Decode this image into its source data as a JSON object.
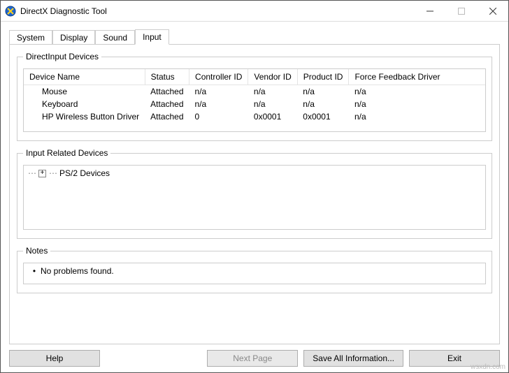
{
  "window": {
    "title": "DirectX Diagnostic Tool"
  },
  "tabs": {
    "items": [
      "System",
      "Display",
      "Sound",
      "Input"
    ],
    "active": "Input"
  },
  "groups": {
    "devices": {
      "legend": "DirectInput Devices",
      "columns": [
        "Device Name",
        "Status",
        "Controller ID",
        "Vendor ID",
        "Product ID",
        "Force Feedback Driver"
      ],
      "rows": [
        {
          "name": "Mouse",
          "status": "Attached",
          "controller": "n/a",
          "vendor": "n/a",
          "product": "n/a",
          "ffd": "n/a"
        },
        {
          "name": "Keyboard",
          "status": "Attached",
          "controller": "n/a",
          "vendor": "n/a",
          "product": "n/a",
          "ffd": "n/a"
        },
        {
          "name": "HP Wireless Button Driver",
          "status": "Attached",
          "controller": "0",
          "vendor": "0x0001",
          "product": "0x0001",
          "ffd": "n/a"
        }
      ]
    },
    "related": {
      "legend": "Input Related Devices",
      "tree": {
        "node0": "PS/2 Devices",
        "expander": "+"
      }
    },
    "notes": {
      "legend": "Notes",
      "items": [
        "No problems found."
      ]
    }
  },
  "buttons": {
    "help": "Help",
    "next": "Next Page",
    "saveall": "Save All Information...",
    "exit": "Exit"
  },
  "watermark": "wsxdn.com"
}
